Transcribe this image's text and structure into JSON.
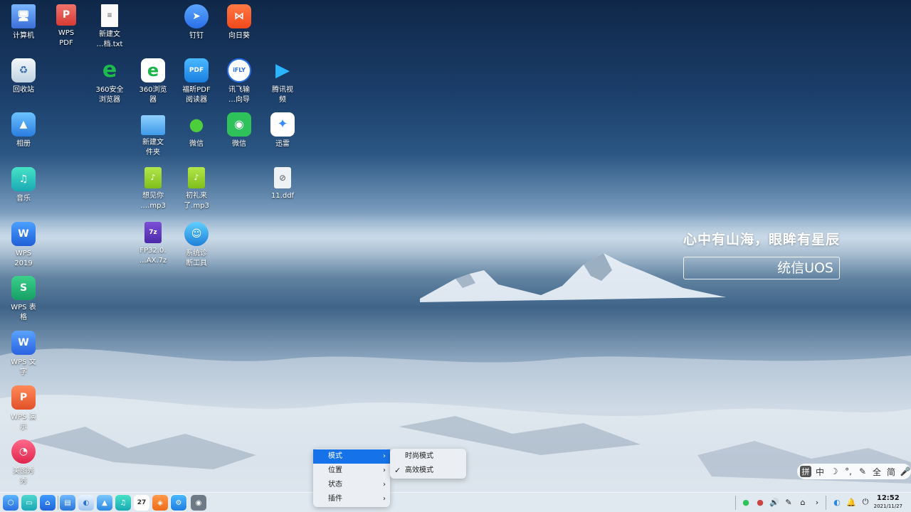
{
  "desktop": {
    "slogan": "心中有山海，眼眸有星辰",
    "brand": "统信UOS",
    "icons": [
      {
        "label": "计算机",
        "icon": "monitor-icon"
      },
      {
        "label": "回收站",
        "icon": "trash-icon"
      },
      {
        "label": "相册",
        "icon": "photo-icon"
      },
      {
        "label": "音乐",
        "icon": "music-icon"
      },
      {
        "label": "WPS\n2019",
        "icon": "wps-icon"
      },
      {
        "label": "WPS 表\n格",
        "icon": "wps-sheet-icon"
      },
      {
        "label": "WPS 文\n字",
        "icon": "wps-writer-icon"
      },
      {
        "label": "WPS 演\n示",
        "icon": "wps-present-icon"
      },
      {
        "label": "美图秀\n秀",
        "icon": "meitu-icon"
      },
      {
        "label": "WPS\nPDF",
        "icon": "wps-pdf-icon"
      },
      {
        "label": "新建文\n…档.txt",
        "icon": "text-file-icon"
      },
      {
        "label": "360安全\n浏览器",
        "icon": "browser-360-icon"
      },
      {
        "label": "360浏览\n器",
        "icon": "browser-360-alt-icon"
      },
      {
        "label": "新建文\n件夹",
        "icon": "folder-icon"
      },
      {
        "label": "想见你\n….mp3",
        "icon": "mp3-file-icon"
      },
      {
        "label": "FP32.0.\n…AX.7z",
        "icon": "archive-icon"
      },
      {
        "label": "钉钉",
        "icon": "dingtalk-icon"
      },
      {
        "label": "福昕PDF\n阅读器",
        "icon": "foxit-icon"
      },
      {
        "label": "微信",
        "icon": "wechat-icon"
      },
      {
        "label": "初礼来\n了.mp3",
        "icon": "mp3-file-icon"
      },
      {
        "label": "系统诊\n断工具",
        "icon": "diagnostic-icon"
      },
      {
        "label": "向日葵",
        "icon": "sunflower-icon"
      },
      {
        "label": "讯飞输\n…向导",
        "icon": "iflytek-icon"
      },
      {
        "label": "微信",
        "icon": "wechat-icon"
      },
      {
        "label": "腾讯视\n频",
        "icon": "tencent-video-icon"
      },
      {
        "label": "迅雷",
        "icon": "thunder-icon"
      },
      {
        "label": "11.ddf",
        "icon": "ddf-file-icon"
      }
    ]
  },
  "menu": {
    "items": [
      {
        "label": "模式"
      },
      {
        "label": "位置"
      },
      {
        "label": "状态"
      },
      {
        "label": "插件"
      }
    ],
    "arrow": "›",
    "submenu": [
      {
        "label": "时尚模式",
        "checked": false
      },
      {
        "label": "高效模式",
        "checked": true
      }
    ],
    "check": "✓"
  },
  "ime": {
    "items": [
      "拼",
      "中",
      "☽",
      "°,",
      "✎",
      "全",
      "简",
      "🎤"
    ]
  },
  "taskbar": {
    "calendar_day": "27",
    "time": "12:52",
    "date": "2021/11/27"
  }
}
